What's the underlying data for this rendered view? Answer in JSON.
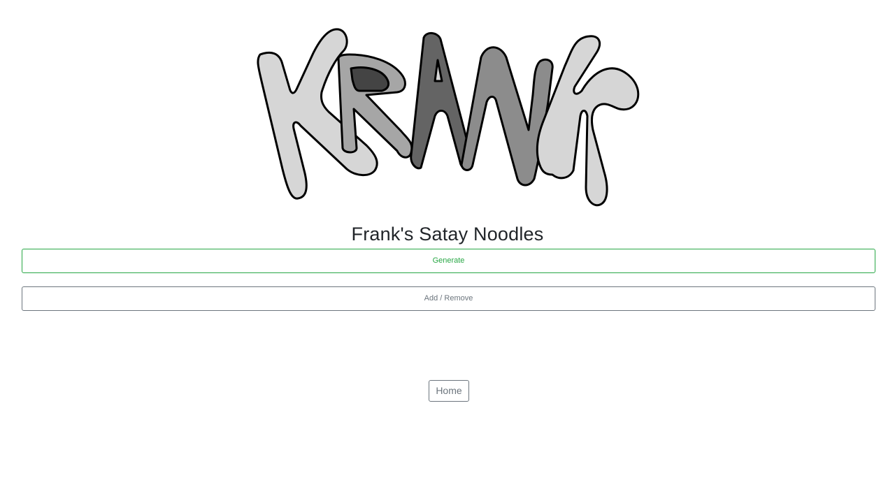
{
  "logo": {
    "text": "KRANK",
    "colors": {
      "light": "#d6d6d6",
      "mid": "#a6a6a6",
      "mid2": "#8c8c8c",
      "dark": "#646464",
      "darkest": "#444444",
      "outline": "#000000"
    }
  },
  "title": "Frank's Satay Noodles",
  "buttons": {
    "generate": "Generate",
    "add_remove": "Add / Remove",
    "home": "Home"
  },
  "colors": {
    "success": "#28a745",
    "secondary": "#6c757d",
    "text": "#212529"
  }
}
